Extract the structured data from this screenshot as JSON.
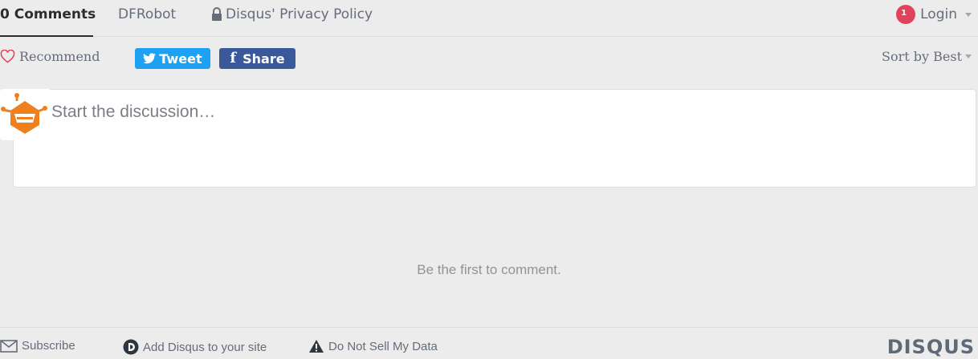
{
  "nav": {
    "comments_tab": "0 Comments",
    "community_tab": "DFRobot",
    "privacy_tab": "Disqus' Privacy Policy",
    "login_label": "Login",
    "notification_count": "1",
    "badge_color": "#e0445b"
  },
  "actions": {
    "recommend_label": "Recommend",
    "tweet_label": "Tweet",
    "share_label": "Share",
    "sort_label": "Sort by Best",
    "tweet_color": "#1da1f2",
    "share_color": "#3b5998"
  },
  "composer": {
    "placeholder": "Start the discussion…",
    "avatar_icon": "dfrobot-logo-icon"
  },
  "empty_state": "Be the first to comment.",
  "footer": {
    "subscribe_label": "Subscribe",
    "add_disqus_label": "Add Disqus to your site",
    "do_not_sell_label": "Do Not Sell My Data",
    "logo_text": "DISQUS"
  }
}
